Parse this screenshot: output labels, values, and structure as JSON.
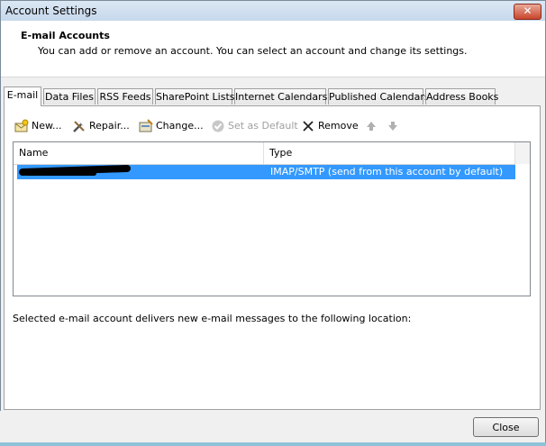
{
  "window": {
    "title": "Account Settings",
    "close_glyph": "✕"
  },
  "header": {
    "title": "E-mail Accounts",
    "subtitle": "You can add or remove an account. You can select an account and change its settings."
  },
  "tabs": [
    {
      "label": "E-mail"
    },
    {
      "label": "Data Files"
    },
    {
      "label": "RSS Feeds"
    },
    {
      "label": "SharePoint Lists"
    },
    {
      "label": "Internet Calendars"
    },
    {
      "label": "Published Calendars"
    },
    {
      "label": "Address Books"
    }
  ],
  "toolbar": {
    "new_label": "New...",
    "repair_label": "Repair...",
    "change_label": "Change...",
    "set_default_label": "Set as Default",
    "remove_label": "Remove"
  },
  "list": {
    "columns": {
      "name": "Name",
      "type": "Type"
    },
    "rows": [
      {
        "name": "",
        "type": "IMAP/SMTP (send from this account by default)"
      }
    ]
  },
  "delivery_text": "Selected e-mail account delivers new e-mail messages to the following location:",
  "footer": {
    "close_label": "Close"
  },
  "colors": {
    "selection": "#3399ff",
    "title_bar": "#c6d8ec",
    "close_button": "#c8442b"
  }
}
